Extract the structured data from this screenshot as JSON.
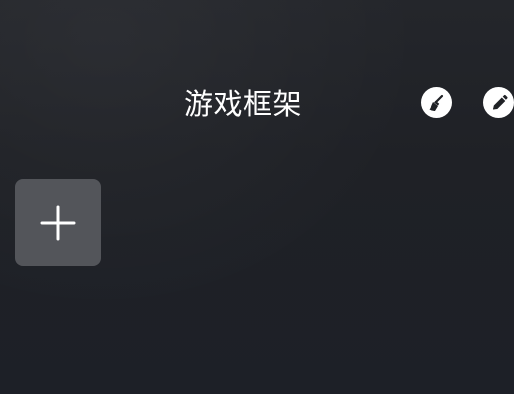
{
  "header": {
    "title": "游戏框架"
  },
  "toolbar": {
    "clean_icon": "broom-icon",
    "edit_icon": "pencil-icon"
  },
  "main": {
    "add_icon": "plus-icon"
  },
  "colors": {
    "background": "#1f2126",
    "tile": "#53555a",
    "foreground": "#ffffff"
  }
}
